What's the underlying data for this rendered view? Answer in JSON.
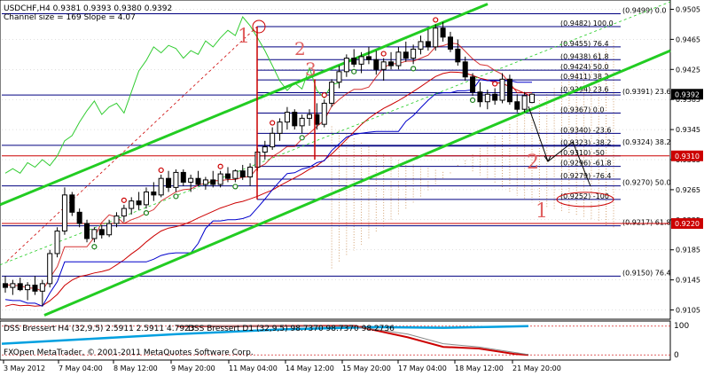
{
  "header": {
    "symbol_line": "USDCHF,H4  0.9381 0.9393 0.9380 0.9392",
    "channel_line": "Channel size = 169 Slope = 4.07"
  },
  "indicator": {
    "label_h4": "DSS Bressert H4 (32,9,5) 2.5911 2.5911 4.7923",
    "label_d1": "DSS Bressert D1 (32,9,5) 98.7370 98.7370 98.2736",
    "copyright": "FXOpen MetaTrader, © 2001-2011 MetaQuotes Software Corp.",
    "axis_top": "100",
    "axis_bottom": "0"
  },
  "colors": {
    "background": "#ffffff",
    "bull_candle": "#ffffff",
    "bear_candle": "#000000",
    "channel": "#22cc22",
    "fib_line": "#000080",
    "red_line": "#cc0000",
    "blue_line": "#0000cc",
    "green_thin": "#33cc33",
    "cloud": "#d2a070",
    "current_price_bg": "#000000",
    "red_level_bg": "#cc0000"
  },
  "chart_data": {
    "type": "candlestick",
    "ylim": [
      0.9095,
      0.9515
    ],
    "y_ticks": [
      "0.9505",
      "0.9465",
      "0.9425",
      "0.9385",
      "0.9345",
      "0.9305",
      "0.9265",
      "0.9225",
      "0.9185",
      "0.9145",
      "0.9105"
    ],
    "x_ticks": [
      "3 May 2012",
      "7 May 04:00",
      "8 May 12:00",
      "9 May 20:00",
      "11 May 04:00",
      "14 May 12:00",
      "15 May 20:00",
      "17 May 04:00",
      "18 May 12:00",
      "21 May 20:00"
    ],
    "price_labels": [
      {
        "text": "0.9392",
        "value": 0.9392,
        "style": "current"
      },
      {
        "text": "0.9310",
        "value": 0.931,
        "style": "red"
      },
      {
        "text": "0.9220",
        "value": 0.922,
        "style": "red"
      }
    ],
    "fib_levels": [
      {
        "label": "(0.9499) 0.0",
        "value": 0.9499
      },
      {
        "label": "(0.9482) 100.0",
        "value": 0.9482
      },
      {
        "label": "(0.9455) 76.4",
        "value": 0.9455
      },
      {
        "label": "(0.9438) 61.8",
        "value": 0.9438
      },
      {
        "label": "(0.9424) 50.0",
        "value": 0.9424
      },
      {
        "label": "(0.9411) 38.2",
        "value": 0.9411
      },
      {
        "label": "(0.9394) 23.6",
        "value": 0.9394
      },
      {
        "label": "(0.9391) 23.6",
        "value": 0.9391
      },
      {
        "label": "(0.9367) 0.0",
        "value": 0.9367
      },
      {
        "label": "(0.9340) -23.6",
        "value": 0.934
      },
      {
        "label": "(0.9323) -38.2",
        "value": 0.9323
      },
      {
        "label": "(0.9324) 38.2",
        "value": 0.9324
      },
      {
        "label": "(0.9310) -50",
        "value": 0.931
      },
      {
        "label": "(0.9296) -61.8",
        "value": 0.9296
      },
      {
        "label": "(0.9279) -76.4",
        "value": 0.9279
      },
      {
        "label": "(0.9270) 50.0",
        "value": 0.927
      },
      {
        "label": "(0.9252) -100",
        "value": 0.9252
      },
      {
        "label": "(0.9217) 61.8",
        "value": 0.9217
      },
      {
        "label": "(0.9150) 76.4",
        "value": 0.915
      }
    ],
    "annotations": [
      "1",
      "2",
      "3",
      "2",
      "1"
    ],
    "candles": [
      {
        "o": 0.914,
        "h": 0.915,
        "l": 0.9128,
        "c": 0.9135
      },
      {
        "o": 0.9135,
        "h": 0.9145,
        "l": 0.9125,
        "c": 0.914
      },
      {
        "o": 0.914,
        "h": 0.9148,
        "l": 0.913,
        "c": 0.9132
      },
      {
        "o": 0.9132,
        "h": 0.9142,
        "l": 0.9118,
        "c": 0.9138
      },
      {
        "o": 0.9138,
        "h": 0.915,
        "l": 0.9125,
        "c": 0.913
      },
      {
        "o": 0.913,
        "h": 0.9145,
        "l": 0.911,
        "c": 0.914
      },
      {
        "o": 0.914,
        "h": 0.9185,
        "l": 0.9135,
        "c": 0.918
      },
      {
        "o": 0.918,
        "h": 0.9215,
        "l": 0.9175,
        "c": 0.921
      },
      {
        "o": 0.921,
        "h": 0.9268,
        "l": 0.9205,
        "c": 0.9258
      },
      {
        "o": 0.9258,
        "h": 0.9262,
        "l": 0.923,
        "c": 0.9235
      },
      {
        "o": 0.9235,
        "h": 0.924,
        "l": 0.9215,
        "c": 0.922
      },
      {
        "o": 0.922,
        "h": 0.9225,
        "l": 0.9195,
        "c": 0.92
      },
      {
        "o": 0.92,
        "h": 0.9215,
        "l": 0.9195,
        "c": 0.9212
      },
      {
        "o": 0.9212,
        "h": 0.9218,
        "l": 0.92,
        "c": 0.9205
      },
      {
        "o": 0.9205,
        "h": 0.9225,
        "l": 0.9202,
        "c": 0.922
      },
      {
        "o": 0.922,
        "h": 0.9235,
        "l": 0.9215,
        "c": 0.923
      },
      {
        "o": 0.923,
        "h": 0.9245,
        "l": 0.9222,
        "c": 0.924
      },
      {
        "o": 0.924,
        "h": 0.9255,
        "l": 0.9232,
        "c": 0.925
      },
      {
        "o": 0.925,
        "h": 0.9262,
        "l": 0.9238,
        "c": 0.9245
      },
      {
        "o": 0.9245,
        "h": 0.9268,
        "l": 0.924,
        "c": 0.9262
      },
      {
        "o": 0.9262,
        "h": 0.9275,
        "l": 0.925,
        "c": 0.9258
      },
      {
        "o": 0.9258,
        "h": 0.9285,
        "l": 0.9255,
        "c": 0.928
      },
      {
        "o": 0.928,
        "h": 0.929,
        "l": 0.9262,
        "c": 0.9268
      },
      {
        "o": 0.9268,
        "h": 0.9292,
        "l": 0.9262,
        "c": 0.9288
      },
      {
        "o": 0.9288,
        "h": 0.9292,
        "l": 0.927,
        "c": 0.9275
      },
      {
        "o": 0.9275,
        "h": 0.9285,
        "l": 0.9262,
        "c": 0.928
      },
      {
        "o": 0.928,
        "h": 0.929,
        "l": 0.927,
        "c": 0.9272
      },
      {
        "o": 0.9272,
        "h": 0.9282,
        "l": 0.9265,
        "c": 0.9278
      },
      {
        "o": 0.9278,
        "h": 0.929,
        "l": 0.9268,
        "c": 0.9272
      },
      {
        "o": 0.9272,
        "h": 0.929,
        "l": 0.9268,
        "c": 0.9286
      },
      {
        "o": 0.9286,
        "h": 0.9295,
        "l": 0.9275,
        "c": 0.928
      },
      {
        "o": 0.928,
        "h": 0.9292,
        "l": 0.9275,
        "c": 0.929
      },
      {
        "o": 0.929,
        "h": 0.9298,
        "l": 0.9278,
        "c": 0.9282
      },
      {
        "o": 0.9282,
        "h": 0.93,
        "l": 0.927,
        "c": 0.9295
      },
      {
        "o": 0.9295,
        "h": 0.932,
        "l": 0.929,
        "c": 0.9315
      },
      {
        "o": 0.9315,
        "h": 0.933,
        "l": 0.9305,
        "c": 0.9322
      },
      {
        "o": 0.9322,
        "h": 0.9348,
        "l": 0.9318,
        "c": 0.934
      },
      {
        "o": 0.934,
        "h": 0.936,
        "l": 0.933,
        "c": 0.9355
      },
      {
        "o": 0.9355,
        "h": 0.9375,
        "l": 0.9345,
        "c": 0.9368
      },
      {
        "o": 0.9368,
        "h": 0.9372,
        "l": 0.9345,
        "c": 0.935
      },
      {
        "o": 0.935,
        "h": 0.9365,
        "l": 0.934,
        "c": 0.936
      },
      {
        "o": 0.936,
        "h": 0.9372,
        "l": 0.935,
        "c": 0.9365
      },
      {
        "o": 0.9365,
        "h": 0.938,
        "l": 0.9345,
        "c": 0.9352
      },
      {
        "o": 0.9352,
        "h": 0.9385,
        "l": 0.9348,
        "c": 0.938
      },
      {
        "o": 0.938,
        "h": 0.9412,
        "l": 0.9375,
        "c": 0.9408
      },
      {
        "o": 0.9408,
        "h": 0.943,
        "l": 0.94,
        "c": 0.9422
      },
      {
        "o": 0.9422,
        "h": 0.9445,
        "l": 0.9415,
        "c": 0.944
      },
      {
        "o": 0.944,
        "h": 0.9452,
        "l": 0.9428,
        "c": 0.9432
      },
      {
        "o": 0.9432,
        "h": 0.9448,
        "l": 0.942,
        "c": 0.9442
      },
      {
        "o": 0.9442,
        "h": 0.9455,
        "l": 0.9432,
        "c": 0.9438
      },
      {
        "o": 0.9438,
        "h": 0.945,
        "l": 0.9418,
        "c": 0.9425
      },
      {
        "o": 0.9425,
        "h": 0.944,
        "l": 0.941,
        "c": 0.9435
      },
      {
        "o": 0.9435,
        "h": 0.9448,
        "l": 0.9425,
        "c": 0.943
      },
      {
        "o": 0.943,
        "h": 0.9455,
        "l": 0.9425,
        "c": 0.9448
      },
      {
        "o": 0.9448,
        "h": 0.9462,
        "l": 0.9435,
        "c": 0.944
      },
      {
        "o": 0.944,
        "h": 0.9458,
        "l": 0.9432,
        "c": 0.9452
      },
      {
        "o": 0.9452,
        "h": 0.947,
        "l": 0.9445,
        "c": 0.9462
      },
      {
        "o": 0.9462,
        "h": 0.9478,
        "l": 0.945,
        "c": 0.9455
      },
      {
        "o": 0.9455,
        "h": 0.9485,
        "l": 0.945,
        "c": 0.948
      },
      {
        "o": 0.948,
        "h": 0.9488,
        "l": 0.9462,
        "c": 0.9468
      },
      {
        "o": 0.9468,
        "h": 0.9475,
        "l": 0.9448,
        "c": 0.9452
      },
      {
        "o": 0.9452,
        "h": 0.9465,
        "l": 0.943,
        "c": 0.9435
      },
      {
        "o": 0.9435,
        "h": 0.9442,
        "l": 0.941,
        "c": 0.9415
      },
      {
        "o": 0.9415,
        "h": 0.942,
        "l": 0.939,
        "c": 0.9395
      },
      {
        "o": 0.9395,
        "h": 0.9408,
        "l": 0.9375,
        "c": 0.9382
      },
      {
        "o": 0.9382,
        "h": 0.9398,
        "l": 0.9372,
        "c": 0.9392
      },
      {
        "o": 0.9392,
        "h": 0.94,
        "l": 0.9378,
        "c": 0.9384
      },
      {
        "o": 0.9384,
        "h": 0.942,
        "l": 0.938,
        "c": 0.9412
      },
      {
        "o": 0.9412,
        "h": 0.9418,
        "l": 0.9378,
        "c": 0.9382
      },
      {
        "o": 0.9382,
        "h": 0.9392,
        "l": 0.9368,
        "c": 0.9372
      },
      {
        "o": 0.9372,
        "h": 0.9395,
        "l": 0.9368,
        "c": 0.939
      },
      {
        "o": 0.9381,
        "h": 0.9393,
        "l": 0.938,
        "c": 0.9392
      }
    ]
  }
}
